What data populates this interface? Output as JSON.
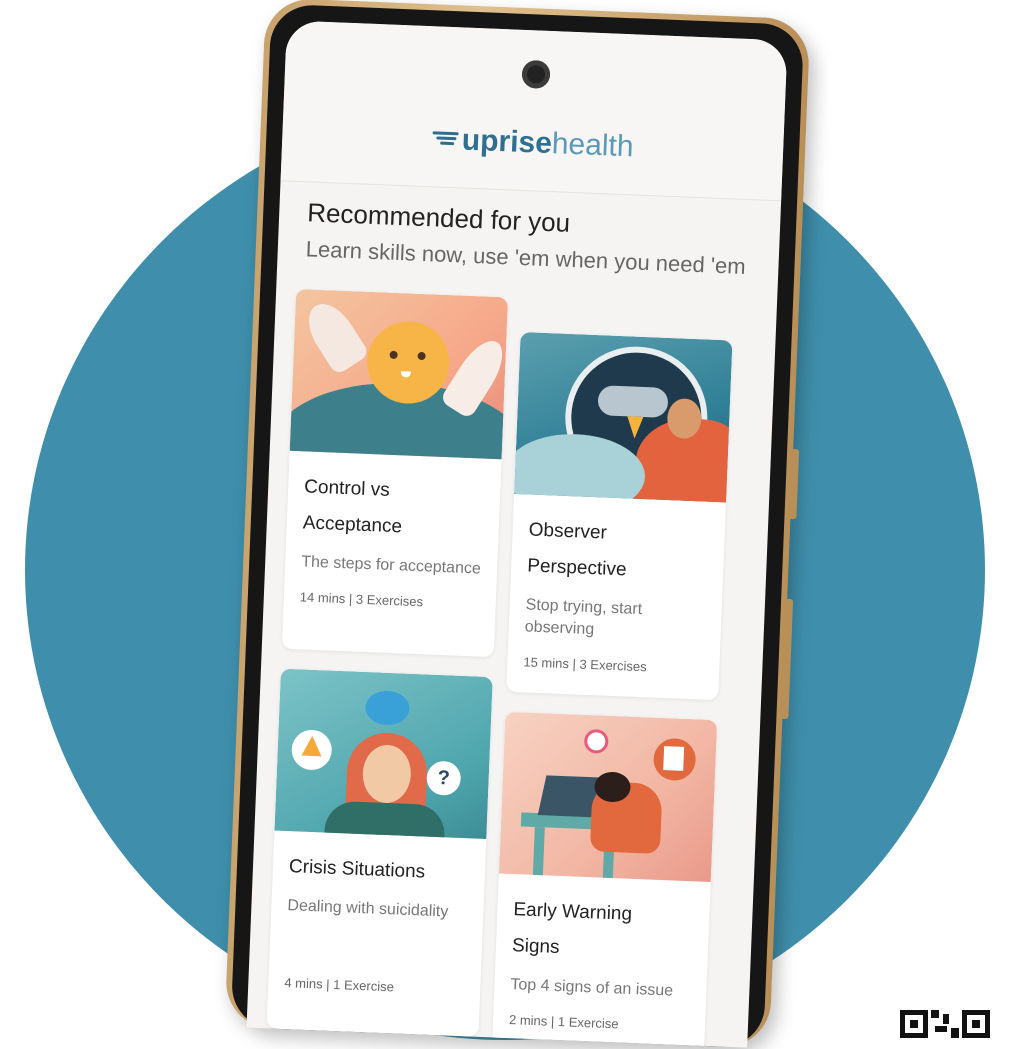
{
  "app": {
    "logo_bold": "uprise",
    "logo_light": "health"
  },
  "section": {
    "title": "Recommended for you",
    "subtitle": "Learn skills now, use 'em when you need 'em"
  },
  "cards": [
    {
      "title_line1": "Control vs",
      "title_line2": "Acceptance",
      "description": "The steps for acceptance",
      "meta": "14 mins | 3 Exercises",
      "illustration": "sun-character-illustration"
    },
    {
      "title_line1": "Observer",
      "title_line2": "Perspective",
      "description": "Stop trying, start observing",
      "meta": "15 mins | 3 Exercises",
      "illustration": "storm-cloud-illustration"
    },
    {
      "title_line1": "Crisis Situations",
      "title_line2": "",
      "description": "Dealing with suicidality",
      "meta": "4 mins | 1 Exercise",
      "illustration": "worried-woman-illustration"
    },
    {
      "title_line1": "Early Warning",
      "title_line2": "Signs",
      "description": "Top 4 signs of an issue",
      "meta": "2 mins | 1 Exercise",
      "illustration": "exhausted-desk-illustration"
    }
  ],
  "colors": {
    "background_circle": "#3f8fac",
    "brand": "#2f6f92",
    "phone_frame": "#d4b07c",
    "screen_bg": "#f5f4f2"
  }
}
